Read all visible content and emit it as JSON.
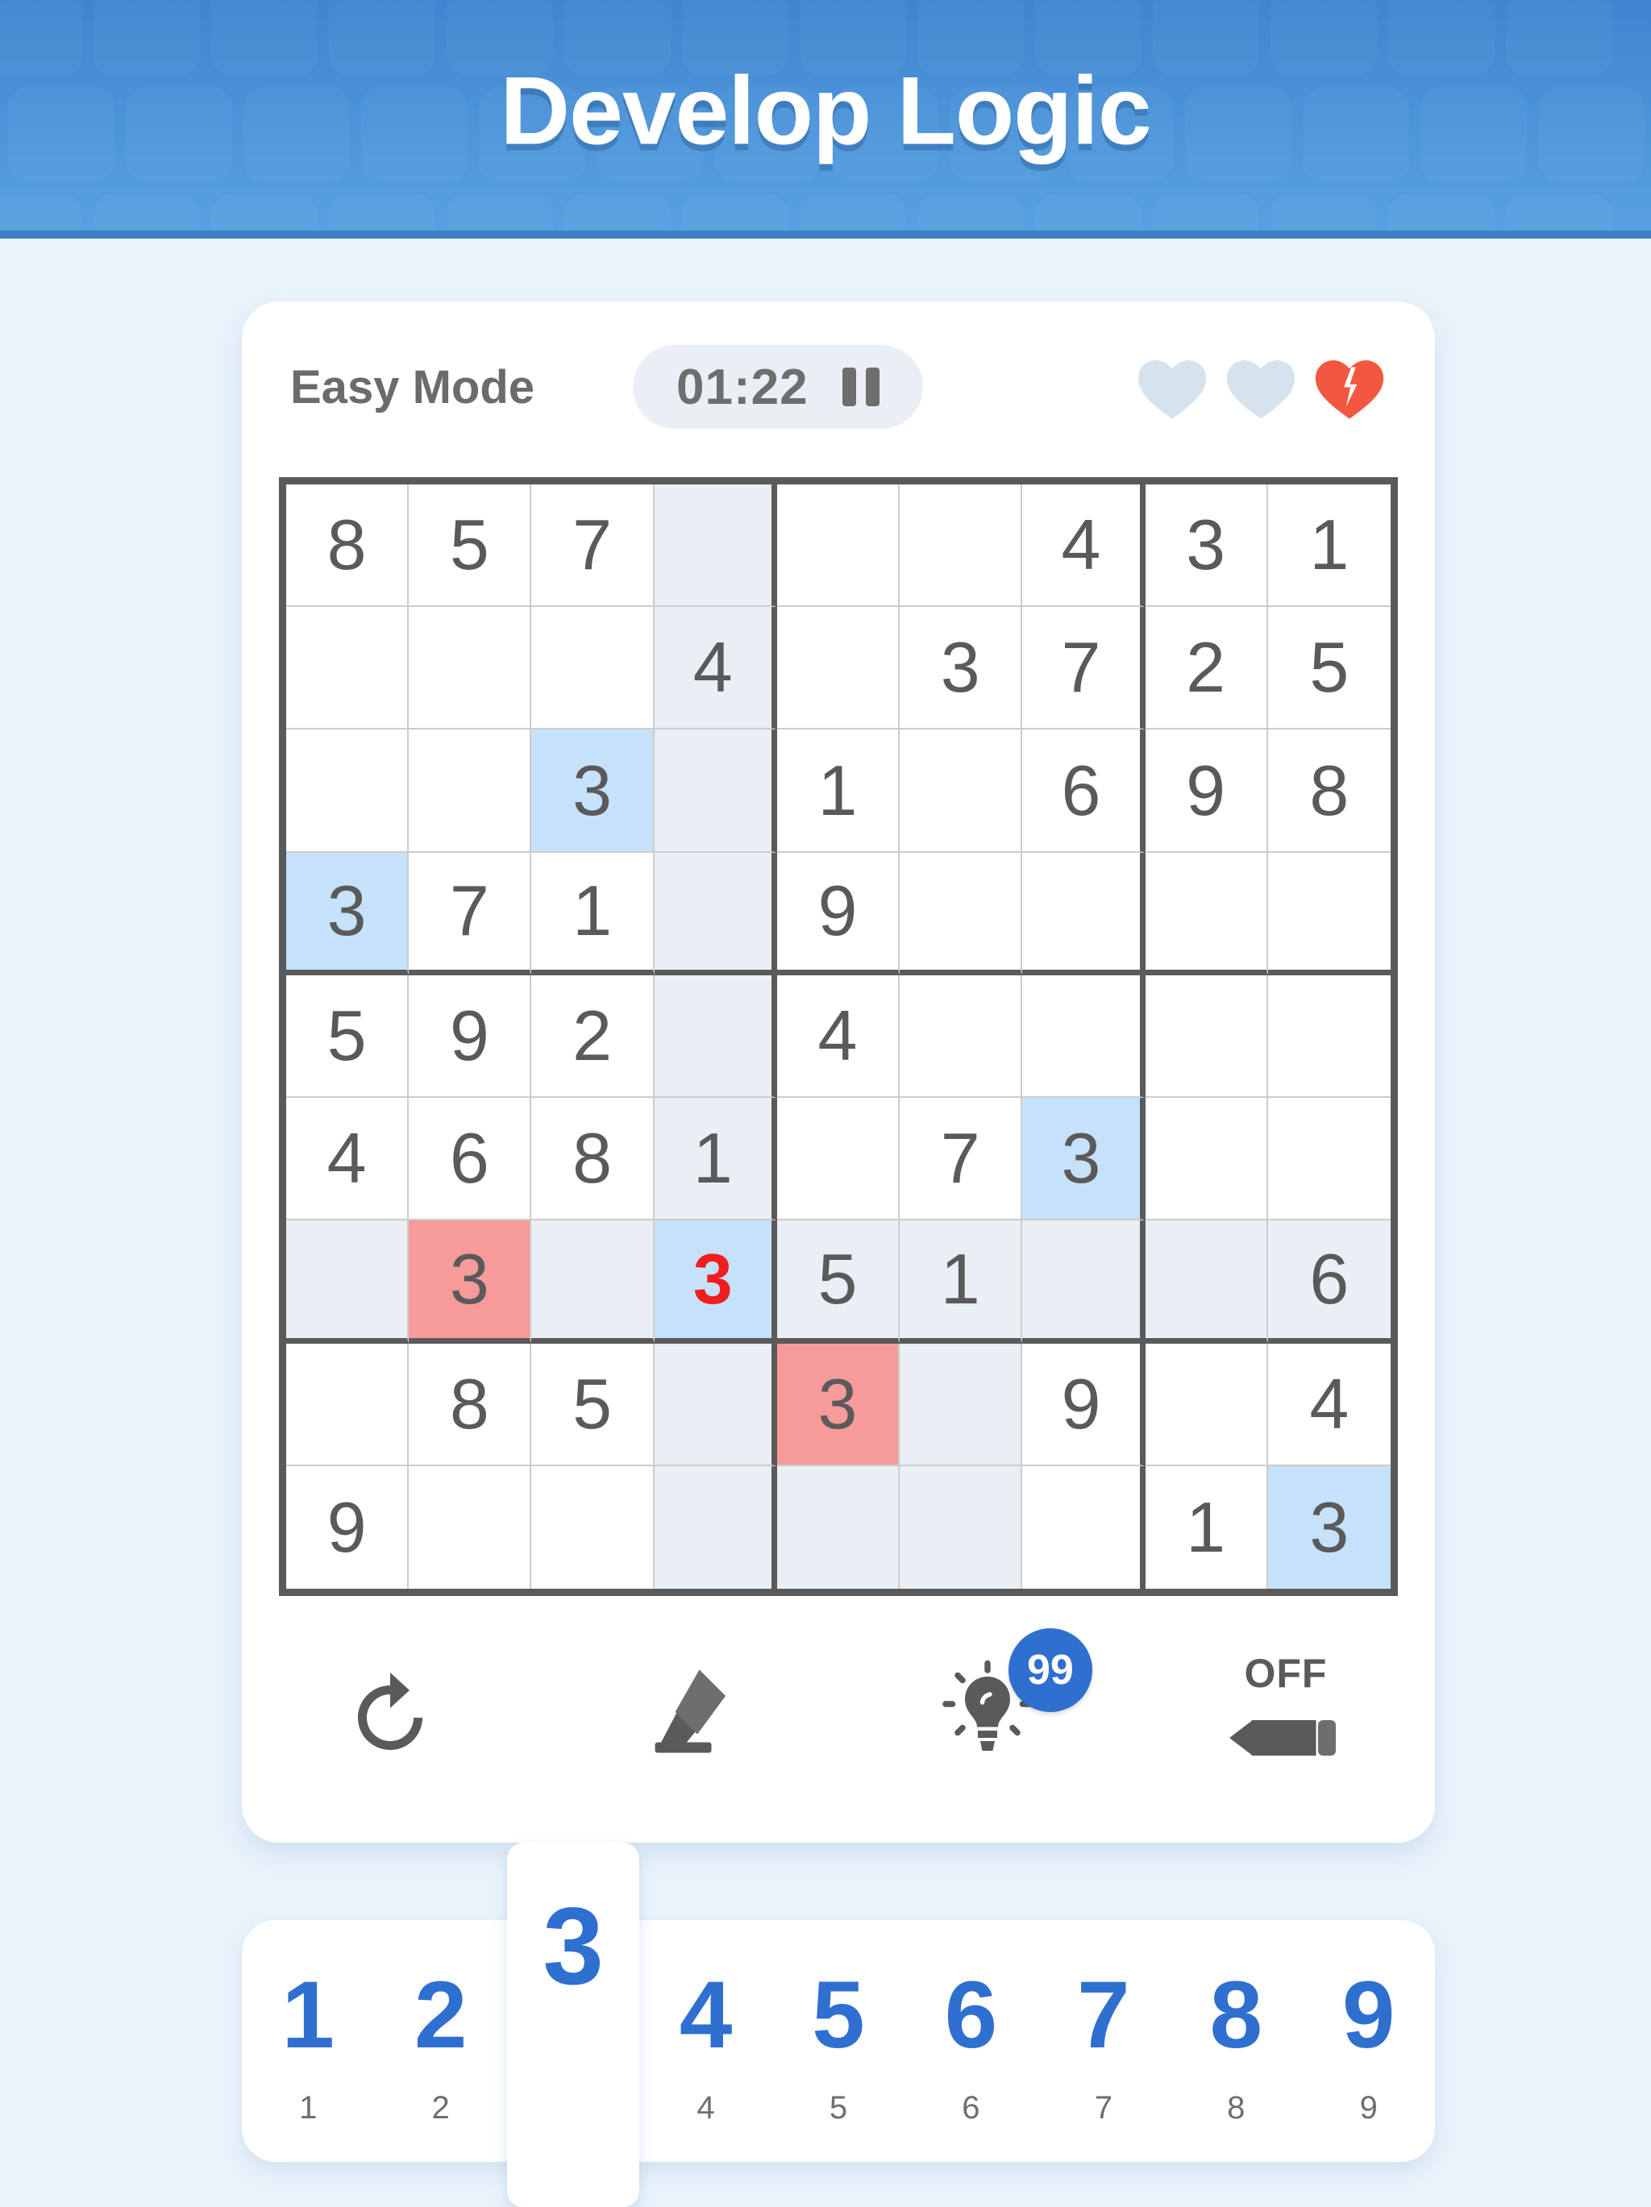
{
  "header": {
    "title": "Develop Logic"
  },
  "status": {
    "mode": "Easy Mode",
    "timer": "01:22",
    "pause_icon": "pause-icon",
    "hearts": [
      {
        "state": "empty",
        "icon": "heart-empty-icon"
      },
      {
        "state": "empty",
        "icon": "heart-empty-icon"
      },
      {
        "state": "broken",
        "icon": "heart-broken-icon"
      }
    ],
    "heart_colors": {
      "empty": "#d6e3ec",
      "broken": "#f2583f"
    }
  },
  "grid": {
    "selected": {
      "row": 7,
      "col": 4,
      "value": "3"
    },
    "rows": [
      [
        {
          "v": "8"
        },
        {
          "v": "5"
        },
        {
          "v": "7"
        },
        {
          "v": "",
          "s": "hl"
        },
        {
          "v": ""
        },
        {
          "v": ""
        },
        {
          "v": "4"
        },
        {
          "v": "3"
        },
        {
          "v": "1"
        }
      ],
      [
        {
          "v": ""
        },
        {
          "v": ""
        },
        {
          "v": ""
        },
        {
          "v": "4",
          "s": "hl"
        },
        {
          "v": ""
        },
        {
          "v": "3"
        },
        {
          "v": "7"
        },
        {
          "v": "2"
        },
        {
          "v": "5"
        }
      ],
      [
        {
          "v": ""
        },
        {
          "v": ""
        },
        {
          "v": "3",
          "s": "same"
        },
        {
          "v": "",
          "s": "hl"
        },
        {
          "v": "1"
        },
        {
          "v": ""
        },
        {
          "v": "6"
        },
        {
          "v": "9"
        },
        {
          "v": "8"
        }
      ],
      [
        {
          "v": "3",
          "s": "same"
        },
        {
          "v": "7"
        },
        {
          "v": "1"
        },
        {
          "v": "",
          "s": "hl"
        },
        {
          "v": "9"
        },
        {
          "v": ""
        },
        {
          "v": ""
        },
        {
          "v": ""
        },
        {
          "v": ""
        }
      ],
      [
        {
          "v": "5"
        },
        {
          "v": "9"
        },
        {
          "v": "2"
        },
        {
          "v": "",
          "s": "hl"
        },
        {
          "v": "4"
        },
        {
          "v": ""
        },
        {
          "v": ""
        },
        {
          "v": ""
        },
        {
          "v": ""
        }
      ],
      [
        {
          "v": "4"
        },
        {
          "v": "6"
        },
        {
          "v": "8"
        },
        {
          "v": "1",
          "s": "hl"
        },
        {
          "v": ""
        },
        {
          "v": "7"
        },
        {
          "v": "3",
          "s": "same"
        },
        {
          "v": ""
        },
        {
          "v": ""
        }
      ],
      [
        {
          "v": "",
          "s": "hl"
        },
        {
          "v": "3",
          "s": "err"
        },
        {
          "v": "",
          "s": "hl"
        },
        {
          "v": "3",
          "s": "sel errtext"
        },
        {
          "v": "5",
          "s": "hl"
        },
        {
          "v": "1",
          "s": "hl"
        },
        {
          "v": "",
          "s": "hl"
        },
        {
          "v": "",
          "s": "hl"
        },
        {
          "v": "6",
          "s": "hl"
        }
      ],
      [
        {
          "v": ""
        },
        {
          "v": "8"
        },
        {
          "v": "5"
        },
        {
          "v": "",
          "s": "hl"
        },
        {
          "v": "3",
          "s": "err"
        },
        {
          "v": "",
          "s": "hl"
        },
        {
          "v": "9"
        },
        {
          "v": ""
        },
        {
          "v": "4"
        }
      ],
      [
        {
          "v": "9"
        },
        {
          "v": ""
        },
        {
          "v": ""
        },
        {
          "v": "",
          "s": "hl"
        },
        {
          "v": "",
          "s": "hl"
        },
        {
          "v": "",
          "s": "hl"
        },
        {
          "v": ""
        },
        {
          "v": "1"
        },
        {
          "v": "3",
          "s": "same"
        }
      ]
    ]
  },
  "toolbar": {
    "undo": {
      "icon": "undo-icon",
      "label": ""
    },
    "erase": {
      "icon": "eraser-icon",
      "label": ""
    },
    "hint": {
      "icon": "lightbulb-icon",
      "badge": "99"
    },
    "notes": {
      "icon": "pencil-icon",
      "label": "OFF"
    }
  },
  "numpad": {
    "keys": [
      {
        "digit": "1",
        "count": "1",
        "active": false
      },
      {
        "digit": "2",
        "count": "2",
        "active": false
      },
      {
        "digit": "3",
        "count": "",
        "active": true
      },
      {
        "digit": "4",
        "count": "4",
        "active": false
      },
      {
        "digit": "5",
        "count": "5",
        "active": false
      },
      {
        "digit": "6",
        "count": "6",
        "active": false
      },
      {
        "digit": "7",
        "count": "7",
        "active": false
      },
      {
        "digit": "8",
        "count": "8",
        "active": false
      },
      {
        "digit": "9",
        "count": "9",
        "active": false
      }
    ]
  },
  "colors": {
    "accent": "#2f6fd0",
    "header_blue": "#4a92d8",
    "page_bg": "#e8f2fb",
    "error_red": "#f79a9a",
    "error_text": "#f01e1e",
    "highlight_blue": "#c5e2fa",
    "highlight_gray": "#e9eff4",
    "grid_line": "#5a5a5a"
  }
}
